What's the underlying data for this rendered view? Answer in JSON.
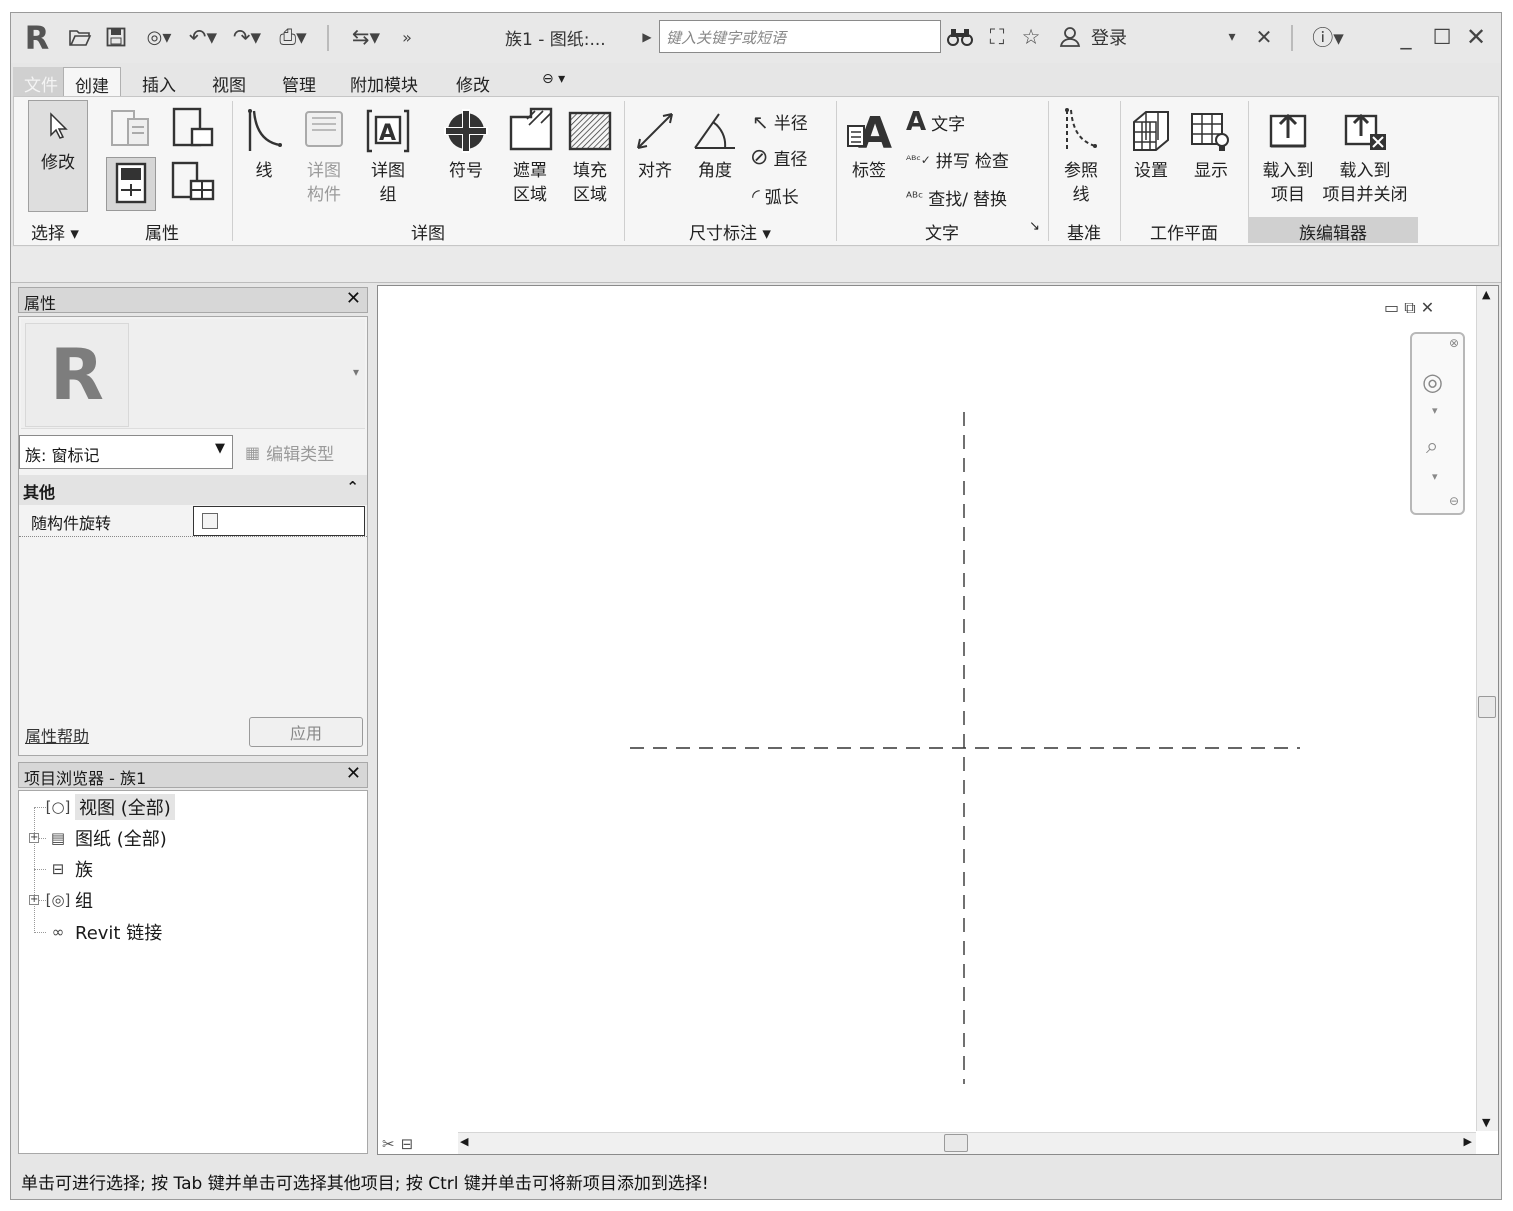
{
  "title_bar": {
    "doc_title": "族1 - 图纸:...",
    "search_placeholder": "键入关键字或短语",
    "sign_in": "登录"
  },
  "tabs": [
    "文件",
    "创建",
    "插入",
    "视图",
    "管理",
    "附加模块",
    "修改"
  ],
  "ribbon": {
    "modify": "修改",
    "line": "线",
    "detail_component": "详图\n构件",
    "detail_group": "详图\n组",
    "symbol": "符号",
    "masking_region": "遮罩\n区域",
    "filled_region": "填充\n区域",
    "aligned": "对齐",
    "angular": "角度",
    "radius": "半径",
    "diameter": "直径",
    "arc_length": "弧长",
    "label": "标签",
    "text": "文字",
    "spelling": "拼写",
    "check": "检查",
    "find": "查找/",
    "replace": "替换",
    "ref_line": "参照\n线",
    "set": "设置",
    "show": "显示",
    "load_into_project": "载入到\n项目",
    "load_and_close": "载入到\n项目并关闭",
    "panels": {
      "select": "选择",
      "properties": "属性",
      "detail": "详图",
      "dimension": "尺寸标注",
      "text": "文字",
      "datum": "基准",
      "work_plane": "工作平面",
      "family_editor": "族编辑器"
    }
  },
  "properties": {
    "header": "属性",
    "type_selector": "族: 窗标记",
    "edit_type": "编辑类型",
    "section": "其他",
    "param_label": "随构件旋转",
    "param_checked": false,
    "help": "属性帮助",
    "apply": "应用"
  },
  "project_browser": {
    "header": "项目浏览器 - 族1",
    "items": [
      {
        "label": "视图 (全部)"
      },
      {
        "label": "图纸 (全部)"
      },
      {
        "label": "族"
      },
      {
        "label": "组"
      },
      {
        "label": "Revit 链接"
      }
    ]
  },
  "status_text": "单击可进行选择; 按 Tab 键并单击可选择其他项目; 按 Ctrl 键并单击可将新项目添加到选择!"
}
